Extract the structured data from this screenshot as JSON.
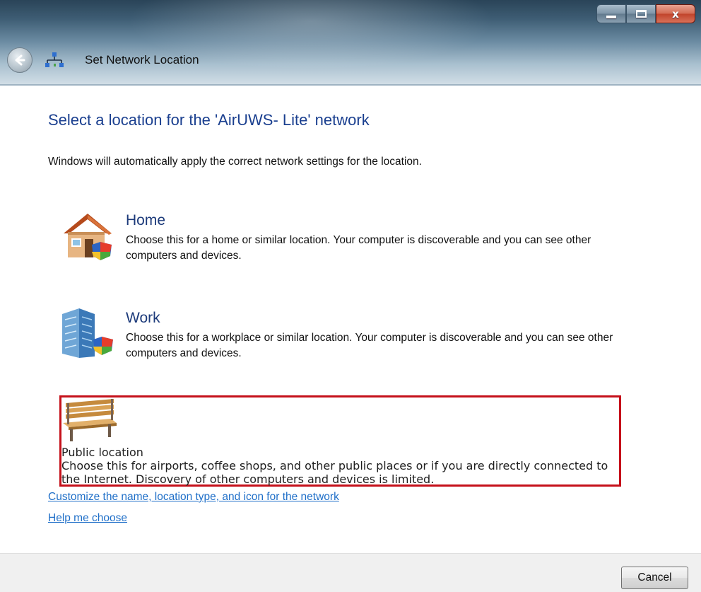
{
  "window": {
    "title": "Set Network Location",
    "controls": {
      "minimize": "minimize",
      "maximize": "maximize",
      "close": "x"
    }
  },
  "main": {
    "heading": "Select a location for the 'AirUWS- Lite' network",
    "subtext": "Windows will automatically apply the correct network settings for the location.",
    "options": [
      {
        "title": "Home",
        "description": "Choose this for a home or similar location. Your computer is discoverable and you can see other computers and devices.",
        "icon": "home-icon"
      },
      {
        "title": "Work",
        "description": "Choose this for a workplace or similar location. Your computer is discoverable and you can see other computers and devices.",
        "icon": "office-building-icon"
      },
      {
        "title": "Public location",
        "description": "Choose this for airports, coffee shops, and other public places or if you are directly connected to the Internet. Discovery of other computers and devices is limited.",
        "icon": "park-bench-icon",
        "highlighted": true
      }
    ],
    "links": {
      "customize": "Customize the name, location type, and icon for the network",
      "help": "Help me choose"
    }
  },
  "footer": {
    "cancel_label": "Cancel"
  },
  "colors": {
    "heading": "#1a3f8f",
    "link": "#1f6fc8",
    "highlight_border": "#c5101a"
  }
}
